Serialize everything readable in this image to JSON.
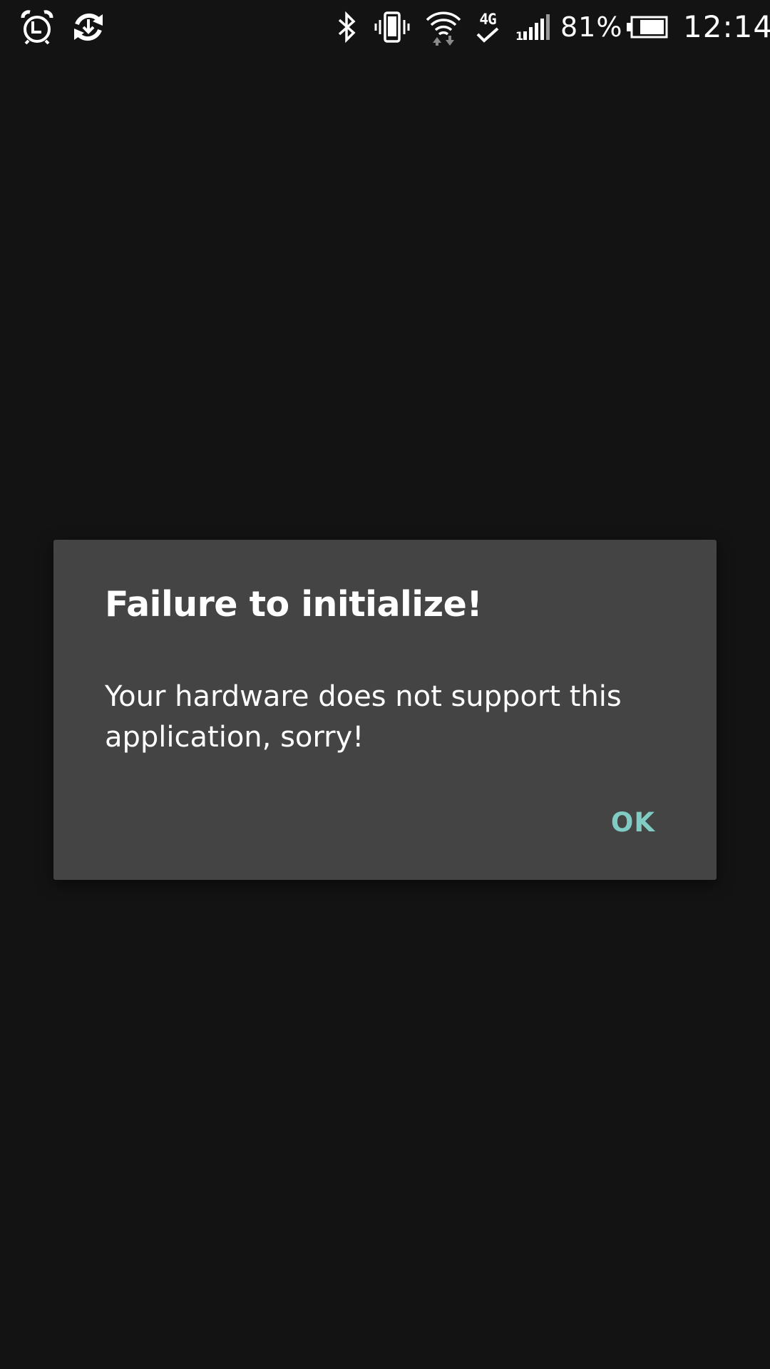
{
  "status_bar": {
    "left_icons": [
      "alarm-icon",
      "sync-icon"
    ],
    "right_icons": [
      "bluetooth-icon",
      "vibrate-icon",
      "wifi-icon",
      "network-4g-icon",
      "signal-icon",
      "battery-icon"
    ],
    "network_label": "4G",
    "battery_percent": "81%",
    "battery_level": 0.81,
    "time": "12:14"
  },
  "dialog": {
    "title": "Failure to initialize!",
    "message": "Your hardware does not support this application, sorry!",
    "ok_label": "OK"
  },
  "colors": {
    "background": "#131313",
    "dialog_background": "#444444",
    "accent": "#80cbc4",
    "text": "#ffffff"
  }
}
